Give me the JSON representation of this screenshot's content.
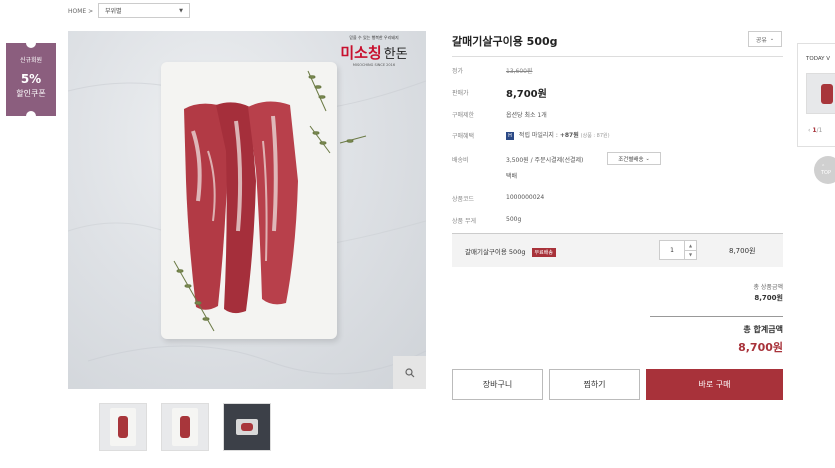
{
  "breadcrumb": {
    "home": "HOME",
    "separator": ">",
    "category": "부위별"
  },
  "coupon": {
    "label": "신규회원",
    "percent": "5%",
    "text": "할인쿠폰"
  },
  "brand": {
    "tagline": "믿을 수 있는 행복한 우리돼지",
    "name_red": "미소칭",
    "name_black": "한돈",
    "english": "MISOCHING SINCE 2016"
  },
  "product": {
    "title": "갈매기살구이용 500g",
    "share_label": "공유",
    "rows": {
      "list_price_label": "정가",
      "list_price": "13,600원",
      "sale_price_label": "판매가",
      "sale_price": "8,700원",
      "purchase_limit_label": "구매제한",
      "purchase_limit": "옵션당 최소 1개",
      "benefit_label": "구매혜택",
      "benefit_badge": "H",
      "benefit_text": "적립 마일리지 :",
      "benefit_amount": "+87원",
      "benefit_note": "(상품 : 87원)",
      "shipping_label": "배송비",
      "shipping_fee": "3,500원",
      "shipping_method": "/ 주문시결제(선결제)",
      "shipping_option": "조건별배송",
      "shipping_company": "택배",
      "code_label": "상품코드",
      "code": "1000000024",
      "weight_label": "상품 무게",
      "weight": "500g"
    }
  },
  "option": {
    "name": "갈매기살구이용 500g",
    "badge": "무료배송",
    "quantity": "1",
    "price": "8,700원"
  },
  "summary": {
    "subtotal_label": "총 상품금액",
    "subtotal": "8,700원",
    "total_label": "총 합계금액",
    "total": "8,700원"
  },
  "buttons": {
    "cart": "장바구니",
    "wish": "찜하기",
    "buy": "바로 구매"
  },
  "today_view": {
    "label": "TODAY V",
    "page_current": "1",
    "page_sep": "/1",
    "prev": "‹"
  },
  "top_button": {
    "label": "TOP"
  },
  "colors": {
    "accent": "#a8323a",
    "coupon": "#8b5e7e",
    "badge_blue": "#2c4a86"
  }
}
